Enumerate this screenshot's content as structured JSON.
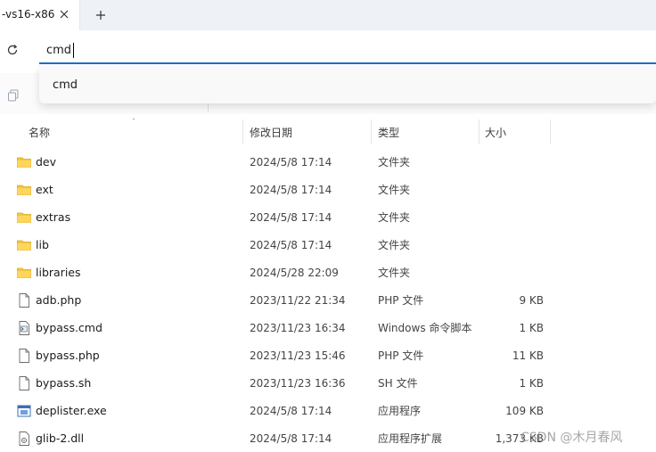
{
  "tab": {
    "title": "-vs16-x86",
    "close_icon": "close-icon",
    "new_tab_icon": "plus-icon"
  },
  "nav": {
    "refresh_icon": "refresh-icon"
  },
  "address": {
    "value": "cmd"
  },
  "suggestion": {
    "item": "cmd"
  },
  "columns": {
    "name": "名称",
    "date": "修改日期",
    "type": "类型",
    "size": "大小"
  },
  "files": [
    {
      "icon": "folder-icon",
      "name": "dev",
      "date": "2024/5/8 17:14",
      "type": "文件夹",
      "size": ""
    },
    {
      "icon": "folder-icon",
      "name": "ext",
      "date": "2024/5/8 17:14",
      "type": "文件夹",
      "size": ""
    },
    {
      "icon": "folder-icon",
      "name": "extras",
      "date": "2024/5/8 17:14",
      "type": "文件夹",
      "size": ""
    },
    {
      "icon": "folder-icon",
      "name": "lib",
      "date": "2024/5/8 17:14",
      "type": "文件夹",
      "size": ""
    },
    {
      "icon": "folder-icon",
      "name": "libraries",
      "date": "2024/5/28 22:09",
      "type": "文件夹",
      "size": ""
    },
    {
      "icon": "file-icon",
      "name": "adb.php",
      "date": "2023/11/22 21:34",
      "type": "PHP 文件",
      "size": "9 KB"
    },
    {
      "icon": "script-file-icon",
      "name": "bypass.cmd",
      "date": "2023/11/23 16:34",
      "type": "Windows 命令脚本",
      "size": "1 KB"
    },
    {
      "icon": "file-icon",
      "name": "bypass.php",
      "date": "2023/11/23 15:46",
      "type": "PHP 文件",
      "size": "11 KB"
    },
    {
      "icon": "file-icon",
      "name": "bypass.sh",
      "date": "2023/11/23 16:36",
      "type": "SH 文件",
      "size": "1 KB"
    },
    {
      "icon": "exe-icon",
      "name": "deplister.exe",
      "date": "2024/5/8 17:14",
      "type": "应用程序",
      "size": "109 KB"
    },
    {
      "icon": "dll-icon",
      "name": "glib-2.dll",
      "date": "2024/5/8 17:14",
      "type": "应用程序扩展",
      "size": "1,373 KB"
    }
  ],
  "watermark": "CSDN @木月春风",
  "colors": {
    "accent": "#1f6fc5",
    "folder": "#f4c542",
    "tabstrip": "#eef2f7"
  }
}
